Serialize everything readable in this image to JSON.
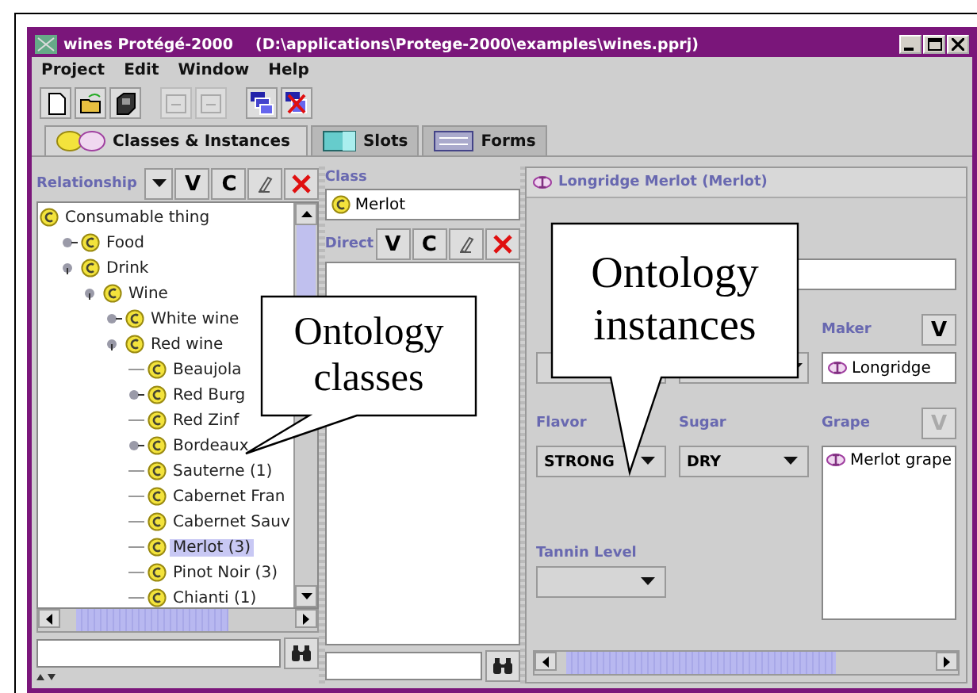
{
  "window": {
    "title": "wines  Protégé-2000",
    "path": "(D:\\applications\\Protege-2000\\examples\\wines.pprj)"
  },
  "menu": [
    "Project",
    "Edit",
    "Window",
    "Help"
  ],
  "toolbar": [
    {
      "kind": "new",
      "disabled": false
    },
    {
      "kind": "open",
      "disabled": false
    },
    {
      "kind": "save",
      "disabled": false
    },
    {
      "kind": "undo",
      "disabled": true
    },
    {
      "kind": "redo",
      "disabled": true
    },
    {
      "kind": "cascade",
      "disabled": false
    },
    {
      "kind": "close-all",
      "disabled": false
    }
  ],
  "tabs": [
    {
      "kind": "classes",
      "label": "Classes & Instances",
      "selected": true
    },
    {
      "kind": "slots",
      "label": "Slots",
      "selected": false
    },
    {
      "kind": "forms",
      "label": "Forms",
      "selected": false
    }
  ],
  "class_panel": {
    "label": "Relationship",
    "buttons": [
      {
        "kind": "text",
        "label": "V"
      },
      {
        "kind": "text",
        "label": "C"
      },
      {
        "kind": "edit"
      },
      {
        "kind": "delete"
      }
    ],
    "tree": [
      {
        "label": "Consumable thing",
        "selected": false,
        "children": [
          {
            "label": "Food",
            "selected": false,
            "expanded": false
          },
          {
            "label": "Drink",
            "selected": false,
            "expanded": true,
            "children": [
              {
                "label": "Wine",
                "selected": false,
                "expanded": true,
                "children": [
                  {
                    "label": "White wine",
                    "selected": false,
                    "expanded": false
                  },
                  {
                    "label": "Red wine",
                    "selected": false,
                    "expanded": true,
                    "children": [
                      {
                        "label": "Beaujola",
                        "selected": false
                      },
                      {
                        "label": "Red Burg",
                        "selected": false,
                        "expanded": false
                      },
                      {
                        "label": "Red Zinf",
                        "selected": false
                      },
                      {
                        "label": "Bordeaux",
                        "selected": false,
                        "expanded": false
                      },
                      {
                        "label": "Sauterne (1)",
                        "selected": false
                      },
                      {
                        "label": "Cabernet Fran",
                        "selected": false
                      },
                      {
                        "label": "Cabernet Sauv",
                        "selected": false
                      },
                      {
                        "label": "Merlot (3)",
                        "selected": true
                      },
                      {
                        "label": "Pinot Noir (3)",
                        "selected": false
                      },
                      {
                        "label": "Chianti (1)",
                        "selected": false
                      }
                    ]
                  }
                ]
              }
            ]
          }
        ]
      }
    ]
  },
  "instance_list": {
    "class_label": "Class",
    "class_value": "Merlot",
    "direct_label": "Direct",
    "buttons": [
      {
        "kind": "text",
        "label": "V"
      },
      {
        "kind": "text",
        "label": "C"
      },
      {
        "kind": "edit"
      },
      {
        "kind": "delete"
      }
    ]
  },
  "instance_form": {
    "title": "Longridge Merlot (Merlot)",
    "maker_label": "Maker",
    "maker_button": "V",
    "maker_value": "Longridge",
    "flavor_label": "Flavor",
    "flavor_value": "STRONG",
    "sugar_label": "Sugar",
    "sugar_value": "DRY",
    "grape_label": "Grape",
    "grape_button": "V",
    "grape_values": [
      "Merlot grape"
    ],
    "tannin_label": "Tannin Level"
  },
  "callouts": [
    {
      "text": "Ontology classes"
    },
    {
      "text": "Ontology instances"
    }
  ]
}
